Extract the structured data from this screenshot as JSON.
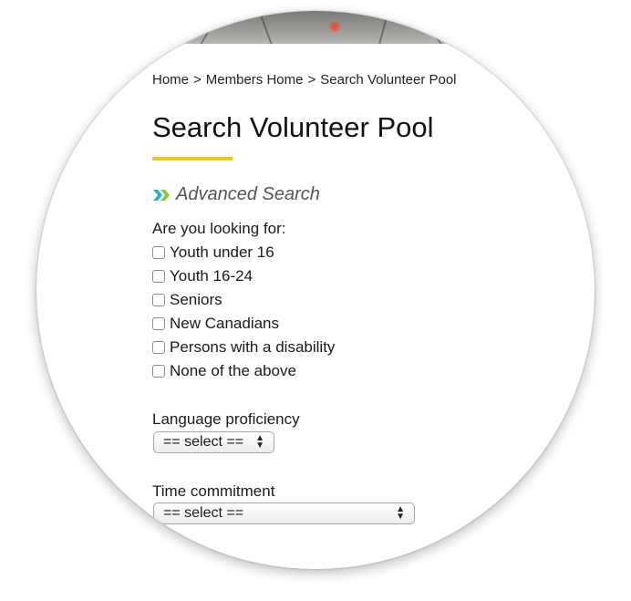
{
  "breadcrumb": {
    "items": [
      "Home",
      "Members Home",
      "Search Volunteer Pool"
    ],
    "separator": ">"
  },
  "page": {
    "title": "Search Volunteer Pool",
    "accent_color": "#f5c518"
  },
  "advanced_search": {
    "label": "Advanced Search",
    "icon": "double-chevron-right-icon",
    "icon_color": "#21b5c9"
  },
  "looking_for": {
    "question": "Are you looking for:",
    "options": [
      {
        "label": "Youth under 16",
        "checked": false
      },
      {
        "label": "Youth 16-24",
        "checked": false
      },
      {
        "label": "Seniors",
        "checked": false
      },
      {
        "label": "New Canadians",
        "checked": false
      },
      {
        "label": "Persons with a disability",
        "checked": false
      },
      {
        "label": "None of the above",
        "checked": false
      }
    ]
  },
  "language": {
    "label": "Language proficiency",
    "selected": "== select =="
  },
  "time": {
    "label": "Time commitment",
    "selected": "== select =="
  }
}
